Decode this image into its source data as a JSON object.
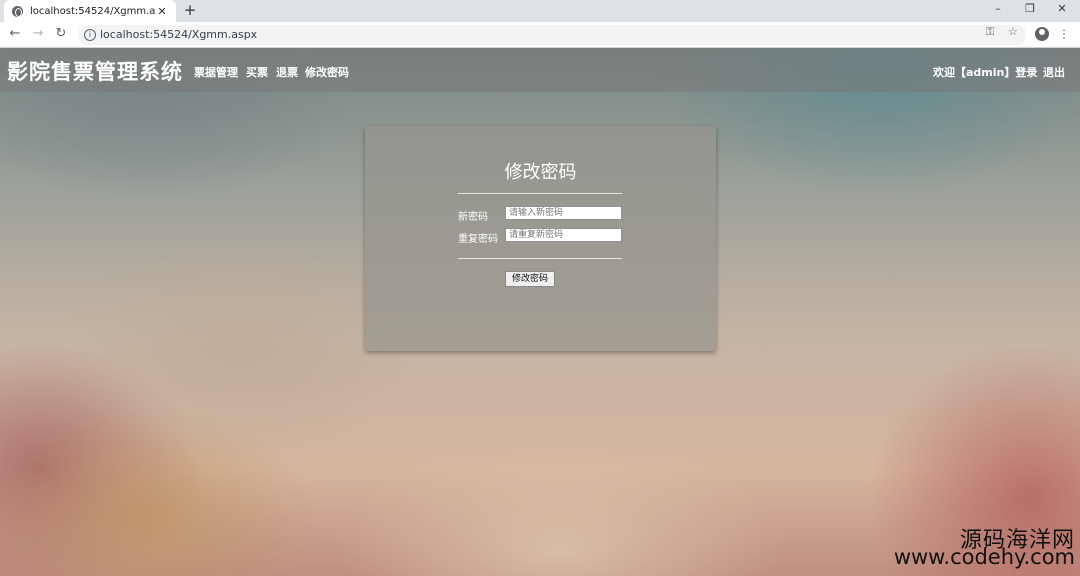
{
  "browser": {
    "tab_title": "localhost:54524/Xgmm.aspx",
    "tab_close": "✕",
    "new_tab": "+",
    "window_controls": {
      "minimize": "–",
      "maximize": "❐",
      "close": "✕"
    },
    "url": "localhost:54524/Xgmm.aspx",
    "icons": [
      "globe-icon",
      "back-icon",
      "forward-icon",
      "reload-icon",
      "info-icon",
      "key-icon",
      "star-icon",
      "profile-icon",
      "menu-icon"
    ]
  },
  "site": {
    "title": "影院售票管理系统",
    "nav": {
      "ticket_data": "票据管理",
      "buy_ticket": "买票",
      "refund_ticket": "退票",
      "change_password": "修改密码"
    },
    "user": {
      "welcome": "欢迎【admin】登录",
      "logout": "退出"
    }
  },
  "form": {
    "title": "修改密码",
    "new_password_label": "新密码",
    "new_password_placeholder": "请输入新密码",
    "repeat_password_label": "重复密码",
    "repeat_password_placeholder": "请重复新密码",
    "submit_label": "修改密码"
  },
  "watermark": {
    "text": "源码海洋网",
    "url": "www.codehy.com"
  }
}
